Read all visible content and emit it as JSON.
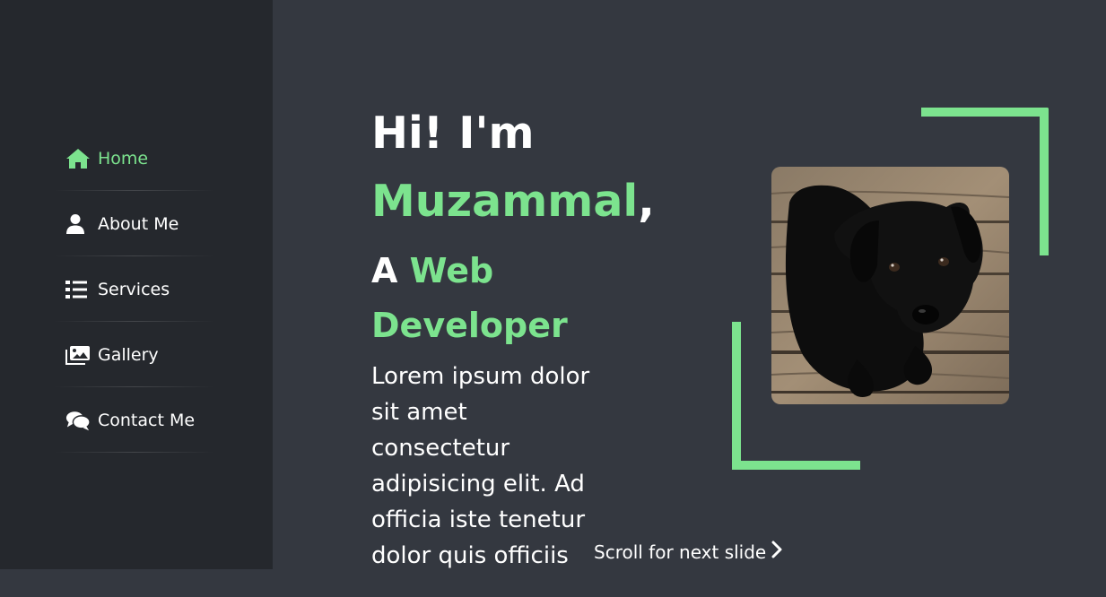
{
  "nav": {
    "items": [
      {
        "label": "Home",
        "icon": "home-icon",
        "active": true
      },
      {
        "label": "About Me",
        "icon": "user-icon",
        "active": false
      },
      {
        "label": "Services",
        "icon": "list-icon",
        "active": false
      },
      {
        "label": "Gallery",
        "icon": "images-icon",
        "active": false
      },
      {
        "label": "Contact Me",
        "icon": "comments-icon",
        "active": false
      }
    ]
  },
  "hero": {
    "greeting": "Hi! I'm",
    "name": "Muzammal",
    "name_suffix": ",",
    "role_prefix": "A ",
    "role": "Web Developer",
    "description": "Lorem ipsum dolor sit amet consectetur adipisicing elit. Ad officia iste tenetur dolor quis officiis"
  },
  "scroll_hint": "Scroll for next slide",
  "colors": {
    "accent": "#7ce38e",
    "sidebar_bg": "#25282d",
    "main_bg": "#343840",
    "text": "#ffffff"
  }
}
